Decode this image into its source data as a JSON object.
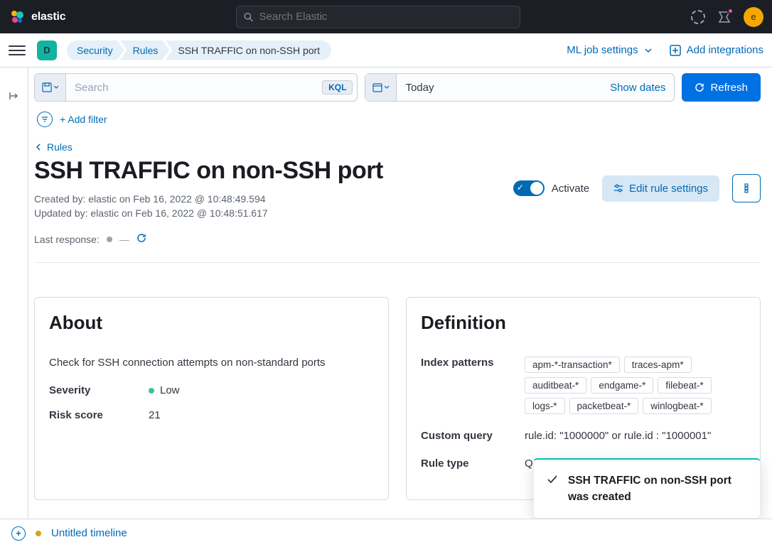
{
  "topbar": {
    "logo_text": "elastic",
    "search_placeholder": "Search Elastic",
    "avatar_letter": "e"
  },
  "subnav": {
    "space_letter": "D",
    "breadcrumbs": [
      "Security",
      "Rules",
      "SSH TRAFFIC on non-SSH port"
    ],
    "ml_link": "ML job settings",
    "add_integrations": "Add integrations"
  },
  "querybar": {
    "search_placeholder": "Search",
    "kql": "KQL",
    "date_value": "Today",
    "show_dates": "Show dates",
    "refresh": "Refresh",
    "add_filter": "+ Add filter"
  },
  "page": {
    "back_label": "Rules",
    "title": "SSH TRAFFIC on non-SSH port",
    "created": "Created by: elastic on Feb 16, 2022 @ 10:48:49.594",
    "updated": "Updated by: elastic on Feb 16, 2022 @ 10:48:51.617",
    "last_response_label": "Last response:",
    "dash": "—",
    "activate_label": "Activate",
    "edit_label": "Edit rule settings"
  },
  "about": {
    "title": "About",
    "desc": "Check for SSH connection attempts on non-standard ports",
    "severity_label": "Severity",
    "severity_value": "Low",
    "risk_label": "Risk score",
    "risk_value": "21"
  },
  "definition": {
    "title": "Definition",
    "index_label": "Index patterns",
    "patterns": [
      "apm-*-transaction*",
      "traces-apm*",
      "auditbeat-*",
      "endgame-*",
      "filebeat-*",
      "logs-*",
      "packetbeat-*",
      "winlogbeat-*"
    ],
    "custom_query_label": "Custom query",
    "custom_query_value": "rule.id: \"1000000\" or rule.id : \"1000001\"",
    "rule_type_label": "Rule type",
    "rule_type_value": "Qu"
  },
  "toast": {
    "message": "SSH TRAFFIC on non-SSH port was created"
  },
  "footer": {
    "timeline_label": "Untitled timeline"
  }
}
